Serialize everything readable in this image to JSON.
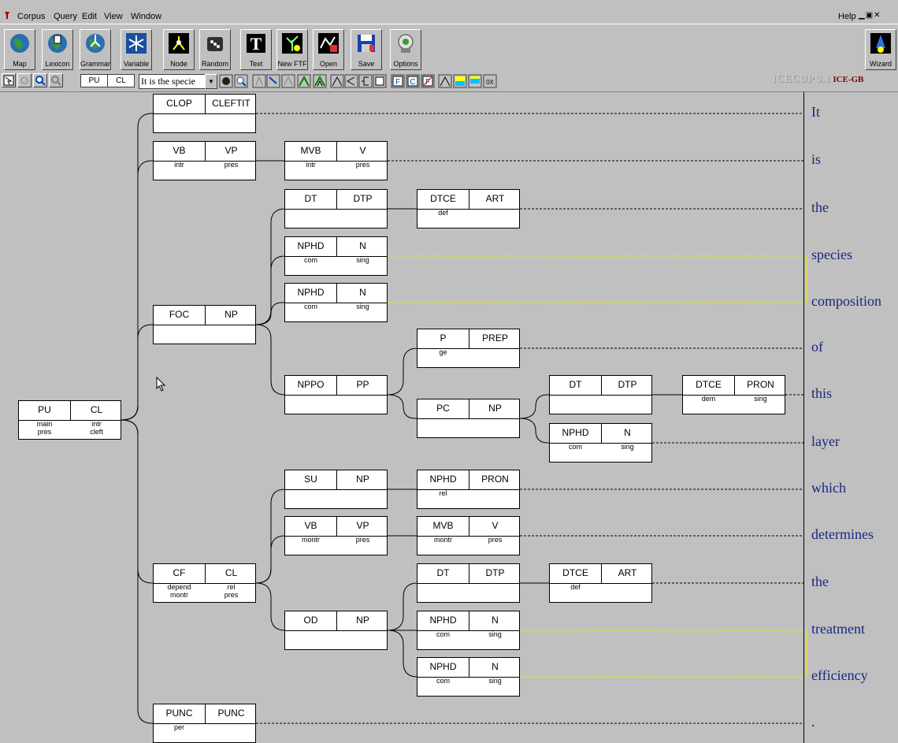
{
  "menu": {
    "items": [
      "Corpus",
      "Query",
      "Edit",
      "View",
      "Window"
    ],
    "help": "Help"
  },
  "toolbar": {
    "buttons": [
      "Map",
      "Lexicon",
      "Grammar",
      "Variable",
      "Node",
      "Random",
      "Text",
      "New FTF",
      "Open",
      "Save",
      "Options"
    ],
    "wizard": "Wizard"
  },
  "querybar": {
    "pu": "PU",
    "cl": "CL",
    "text_value": "It is the specie",
    "brand_name": "ICECUP 3.1",
    "corpus": "ICE-GB"
  },
  "tree": {
    "nodes": [
      {
        "id": "pu",
        "fn": "PU",
        "cat": "CL",
        "f1": "main\npres",
        "f2": "intr\ncleft"
      },
      {
        "id": "clop",
        "fn": "CLOP",
        "cat": "CLEFTIT",
        "f1": "",
        "f2": ""
      },
      {
        "id": "vb1",
        "fn": "VB",
        "cat": "VP",
        "f1": "intr",
        "f2": "pres"
      },
      {
        "id": "mvb1",
        "fn": "MVB",
        "cat": "V",
        "f1": "intr",
        "f2": "pres"
      },
      {
        "id": "foc",
        "fn": "FOC",
        "cat": "NP",
        "f1": "",
        "f2": ""
      },
      {
        "id": "dt1",
        "fn": "DT",
        "cat": "DTP",
        "f1": "",
        "f2": ""
      },
      {
        "id": "dtce1",
        "fn": "DTCE",
        "cat": "ART",
        "f1": "def",
        "f2": ""
      },
      {
        "id": "nphd1",
        "fn": "NPHD",
        "cat": "N",
        "f1": "com",
        "f2": "sing"
      },
      {
        "id": "nphd2",
        "fn": "NPHD",
        "cat": "N",
        "f1": "com",
        "f2": "sing"
      },
      {
        "id": "nppo",
        "fn": "NPPO",
        "cat": "PP",
        "f1": "",
        "f2": ""
      },
      {
        "id": "p",
        "fn": "P",
        "cat": "PREP",
        "f1": "ge",
        "f2": ""
      },
      {
        "id": "pc",
        "fn": "PC",
        "cat": "NP",
        "f1": "",
        "f2": ""
      },
      {
        "id": "dt2",
        "fn": "DT",
        "cat": "DTP",
        "f1": "",
        "f2": ""
      },
      {
        "id": "dtce2",
        "fn": "DTCE",
        "cat": "PRON",
        "f1": "dem",
        "f2": "sing"
      },
      {
        "id": "nphd3",
        "fn": "NPHD",
        "cat": "N",
        "f1": "com",
        "f2": "sing"
      },
      {
        "id": "cf",
        "fn": "CF",
        "cat": "CL",
        "f1": "depend\nmontr",
        "f2": "rel\npres"
      },
      {
        "id": "su",
        "fn": "SU",
        "cat": "NP",
        "f1": "",
        "f2": ""
      },
      {
        "id": "nphd4",
        "fn": "NPHD",
        "cat": "PRON",
        "f1": "rel",
        "f2": ""
      },
      {
        "id": "vb2",
        "fn": "VB",
        "cat": "VP",
        "f1": "montr",
        "f2": "pres"
      },
      {
        "id": "mvb2",
        "fn": "MVB",
        "cat": "V",
        "f1": "montr",
        "f2": "pres"
      },
      {
        "id": "od",
        "fn": "OD",
        "cat": "NP",
        "f1": "",
        "f2": ""
      },
      {
        "id": "dt3",
        "fn": "DT",
        "cat": "DTP",
        "f1": "",
        "f2": ""
      },
      {
        "id": "dtce3",
        "fn": "DTCE",
        "cat": "ART",
        "f1": "def",
        "f2": ""
      },
      {
        "id": "nphd5",
        "fn": "NPHD",
        "cat": "N",
        "f1": "com",
        "f2": "sing"
      },
      {
        "id": "nphd6",
        "fn": "NPHD",
        "cat": "N",
        "f1": "com",
        "f2": "sing"
      },
      {
        "id": "punc",
        "fn": "PUNC",
        "cat": "PUNC",
        "f1": "per",
        "f2": ""
      }
    ],
    "words": [
      "It",
      "is",
      "the",
      "species",
      "composition",
      "of",
      "this",
      "layer",
      "which",
      "determines",
      "the",
      "treatment",
      "efficiency",
      "."
    ]
  },
  "colors": {
    "background": "#c0c0c0",
    "word_text": "#1a2680",
    "compound_link": "#f0f000",
    "brand_dark": "#800000"
  }
}
